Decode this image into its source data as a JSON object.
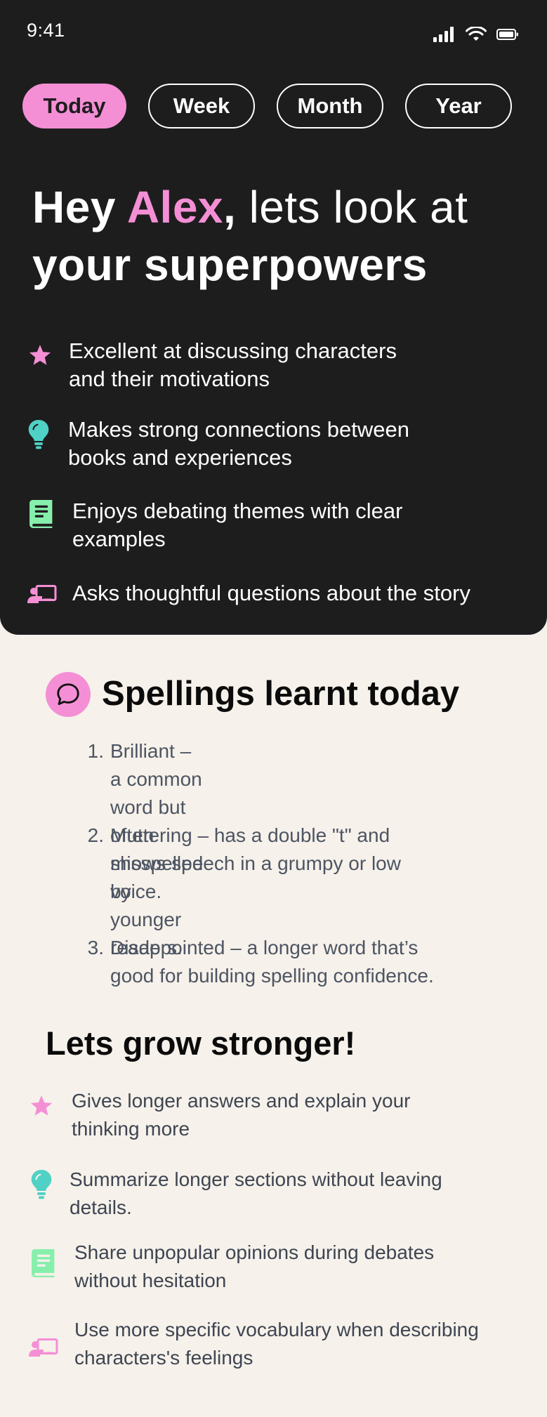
{
  "status_bar": {
    "time": "9:41"
  },
  "tabs": [
    {
      "label": "Today",
      "active": true
    },
    {
      "label": "Week",
      "active": false
    },
    {
      "label": "Month",
      "active": false
    },
    {
      "label": "Year",
      "active": false
    }
  ],
  "hero": {
    "greeting_hey": "Hey ",
    "name": "Alex",
    "comma": ",",
    "rest_line1": " lets look at",
    "line2": "your superpowers"
  },
  "superpowers": [
    {
      "icon": "star-icon",
      "line1": "Excellent at discussing characters",
      "line2": "and their motivations"
    },
    {
      "icon": "lightbulb-icon",
      "line1": "Makes strong connections between",
      "line2": "books and experiences"
    },
    {
      "icon": "book-icon",
      "line1": "Enjoys debating themes with clear",
      "line2": "examples"
    },
    {
      "icon": "presenter-icon",
      "line1": "Asks thoughtful questions about the story",
      "line2": ""
    }
  ],
  "spellings": {
    "title": "Spellings learnt today",
    "items": [
      {
        "num": "1.",
        "lines": [
          "Brilliant – a common word but often",
          "misspelled by younger readers."
        ]
      },
      {
        "num": "2.",
        "lines": [
          "Muttering – has a double \"t\" and",
          "shows speech in a grumpy or low",
          "voice."
        ]
      },
      {
        "num": "3.",
        "lines": [
          "Disappointed – a longer word that’s",
          "good for building spelling confidence."
        ]
      }
    ]
  },
  "grow": {
    "title": "Lets grow stronger!",
    "items": [
      {
        "icon": "star-icon",
        "line1": "Gives longer answers and explain your",
        "line2": "thinking more"
      },
      {
        "icon": "lightbulb-icon",
        "line1": "Summarize longer sections without leaving",
        "line2": "details."
      },
      {
        "icon": "book-icon",
        "line1": "Share unpopular opinions during debates",
        "line2": "without hesitation"
      },
      {
        "icon": "presenter-icon",
        "line1": "Use more specific vocabulary when describing",
        "line2": "characters's feelings"
      }
    ]
  },
  "colors": {
    "dark_bg": "#1e1d1e",
    "light_bg": "#f6f1ea",
    "pink": "#f48fd5",
    "teal": "#4fd1c5",
    "green": "#86efac"
  }
}
